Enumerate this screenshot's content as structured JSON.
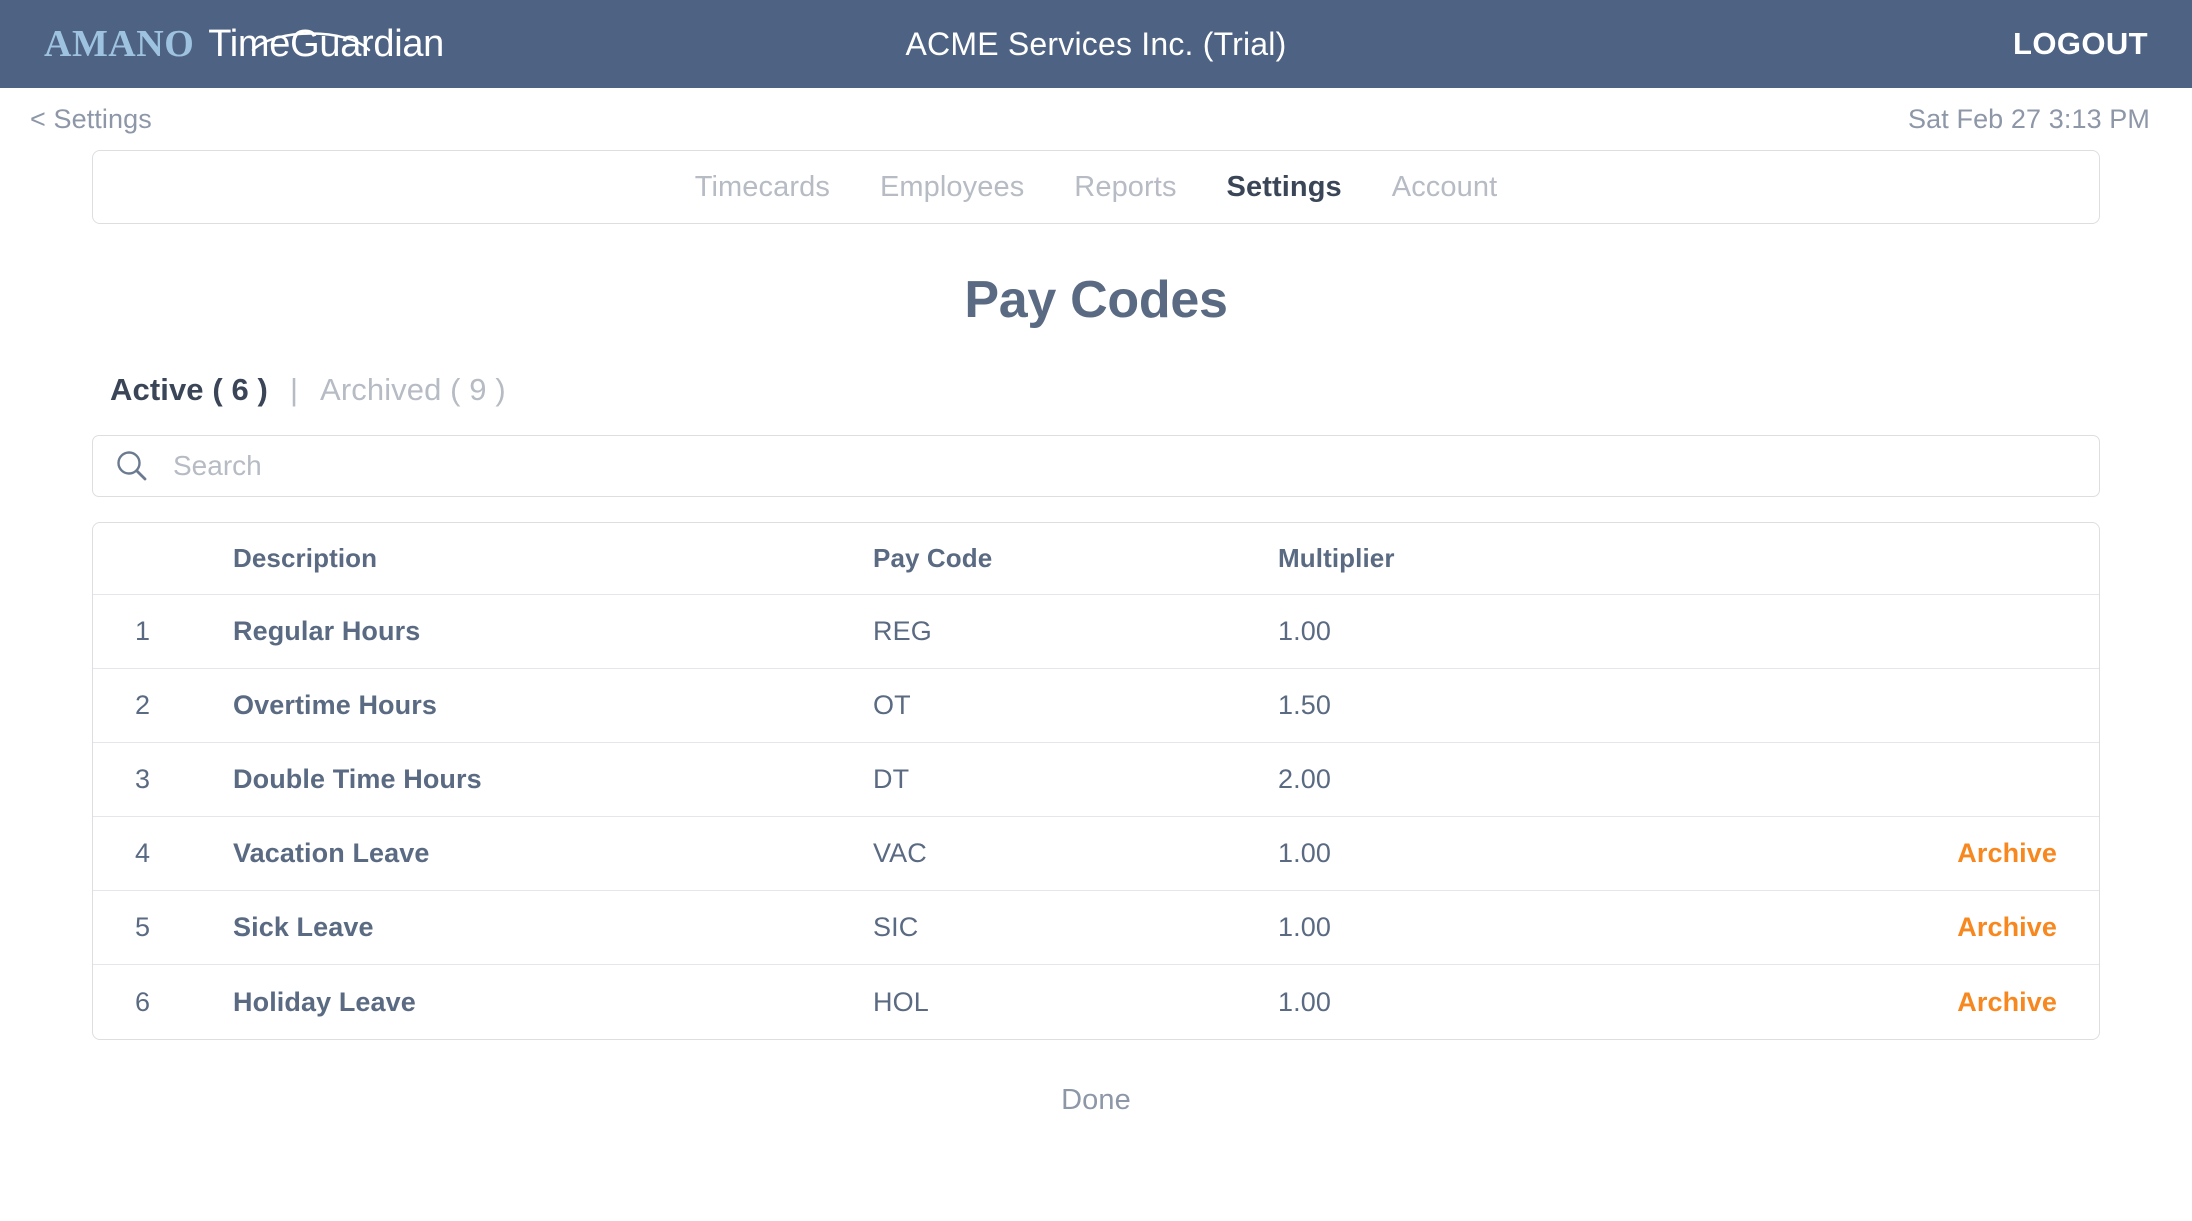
{
  "header": {
    "brand_primary": "AMANO",
    "brand_secondary": "TimeGuardian",
    "company_title": "ACME Services Inc. (Trial)",
    "logout_label": "LOGOUT",
    "bar_color": "#4E6283",
    "brand_primary_color": "#9DC3E0"
  },
  "subheader": {
    "breadcrumb": "< Settings",
    "clock": "Sat Feb 27 3:13 PM"
  },
  "nav": {
    "items": [
      {
        "label": "Timecards",
        "active": false
      },
      {
        "label": "Employees",
        "active": false
      },
      {
        "label": "Reports",
        "active": false
      },
      {
        "label": "Settings",
        "active": true
      },
      {
        "label": "Account",
        "active": false
      }
    ]
  },
  "page": {
    "title": "Pay Codes"
  },
  "filters": {
    "active_label": "Active ( 6 )",
    "separator": "|",
    "archived_label": "Archived ( 9 )"
  },
  "search": {
    "placeholder": "Search",
    "value": "",
    "icon": "search-icon"
  },
  "table": {
    "columns": {
      "num": "",
      "description": "Description",
      "pay_code": "Pay Code",
      "multiplier": "Multiplier",
      "action": ""
    },
    "rows": [
      {
        "num": "1",
        "description": "Regular Hours",
        "pay_code": "REG",
        "multiplier": "1.00",
        "action": ""
      },
      {
        "num": "2",
        "description": "Overtime Hours",
        "pay_code": "OT",
        "multiplier": "1.50",
        "action": ""
      },
      {
        "num": "3",
        "description": "Double Time Hours",
        "pay_code": "DT",
        "multiplier": "2.00",
        "action": ""
      },
      {
        "num": "4",
        "description": "Vacation Leave",
        "pay_code": "VAC",
        "multiplier": "1.00",
        "action": "Archive"
      },
      {
        "num": "5",
        "description": "Sick Leave",
        "pay_code": "SIC",
        "multiplier": "1.00",
        "action": "Archive"
      },
      {
        "num": "6",
        "description": "Holiday Leave",
        "pay_code": "HOL",
        "multiplier": "1.00",
        "action": "Archive"
      }
    ]
  },
  "footer": {
    "done_label": "Done"
  },
  "colors": {
    "accent_orange": "#F7881F",
    "slate": "#5A6A82",
    "muted": "#B6BBC4"
  }
}
